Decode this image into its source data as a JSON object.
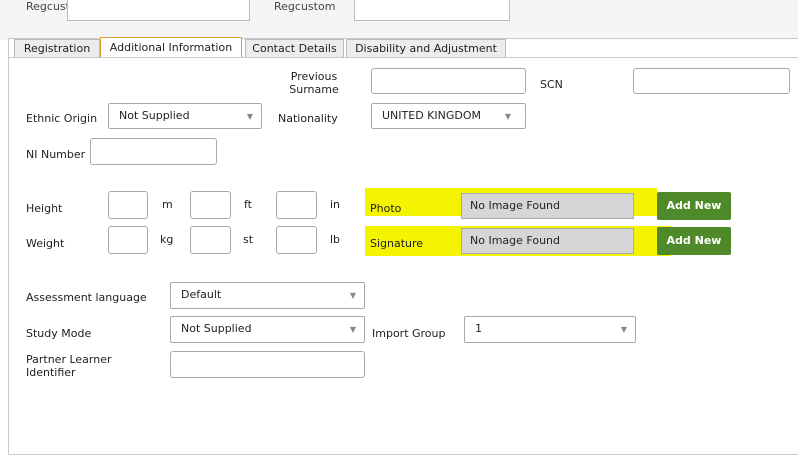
{
  "top": {
    "label_left": "Regcustom",
    "label_right": "Regcustom"
  },
  "tabs": [
    {
      "label": "Registration"
    },
    {
      "label": "Additional Information"
    },
    {
      "label": "Contact Details"
    },
    {
      "label": "Disability and Adjustment"
    }
  ],
  "form": {
    "previous_surname_label": "Previous Surname",
    "scn_label": "SCN",
    "ethnic_origin_label": "Ethnic Origin",
    "ethnic_origin_value": "Not Supplied",
    "nationality_label": "Nationality",
    "nationality_value": "UNITED KINGDOM",
    "ni_number_label": "NI Number",
    "height_label": "Height",
    "weight_label": "Weight",
    "unit_m": "m",
    "unit_ft": "ft",
    "unit_in": "in",
    "unit_kg": "kg",
    "unit_st": "st",
    "unit_lb": "lb",
    "photo_label": "Photo",
    "photo_value": "No Image Found",
    "signature_label": "Signature",
    "signature_value": "No Image Found",
    "add_new_label": "Add New",
    "assessment_language_label": "Assessment language",
    "assessment_language_value": "Default",
    "study_mode_label": "Study Mode",
    "study_mode_value": "Not Supplied",
    "import_group_label": "Import Group",
    "import_group_value": "1",
    "partner_learner_label": "Partner Learner Identifier"
  },
  "colors": {
    "highlight": "#f4f400",
    "button": "#4e8a2a",
    "active_tab_border": "#e0a033"
  }
}
